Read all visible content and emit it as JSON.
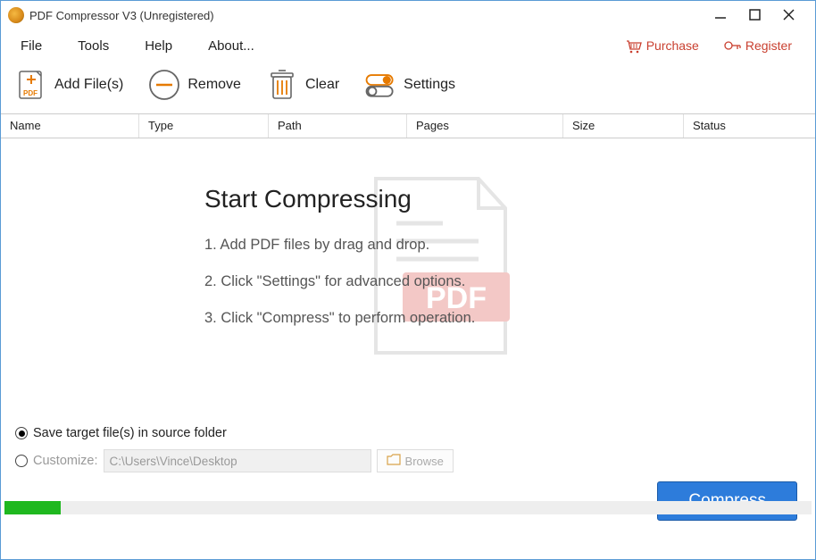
{
  "window": {
    "title": "PDF Compressor V3 (Unregistered)"
  },
  "menu": {
    "file": "File",
    "tools": "Tools",
    "help": "Help",
    "about": "About..."
  },
  "topRight": {
    "purchase": "Purchase",
    "register": "Register"
  },
  "toolbar": {
    "addFiles": "Add File(s)",
    "remove": "Remove",
    "clear": "Clear",
    "settings": "Settings"
  },
  "columns": {
    "name": "Name",
    "type": "Type",
    "path": "Path",
    "pages": "Pages",
    "size": "Size",
    "status": "Status"
  },
  "intro": {
    "heading": "Start Compressing",
    "step1": "1. Add PDF files by drag and drop.",
    "step2": "2. Click \"Settings\" for advanced options.",
    "step3": "3. Click \"Compress\" to perform operation."
  },
  "output": {
    "saveSource": "Save target file(s) in source folder",
    "customize": "Customize:",
    "path": "C:\\Users\\Vince\\Desktop",
    "browse": "Browse"
  },
  "action": {
    "compress": "Compress"
  }
}
